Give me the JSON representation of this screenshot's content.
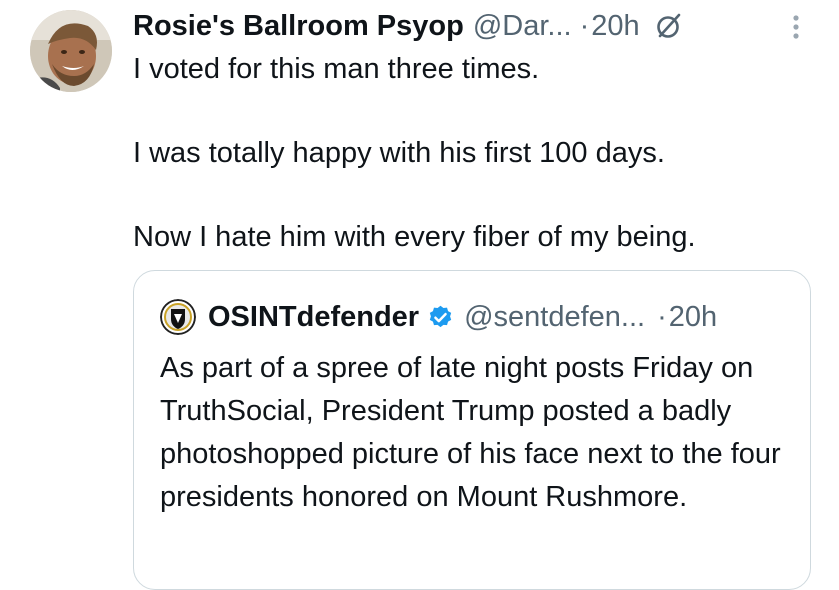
{
  "tweet": {
    "display_name": "Rosie's Ballroom Psyop",
    "handle": "@Dar...",
    "separator": "·",
    "time": "20h",
    "paragraphs": [
      "I voted for this man three times.",
      "I was totally happy with his first 100 days.",
      "Now I hate him with every fiber of my being."
    ],
    "icons": {
      "avatar": "avatar-photo",
      "grok": "grok-icon",
      "more": "more-vertical-icon"
    }
  },
  "quote": {
    "display_name": "OSINTdefender",
    "handle": "@sentdefen...",
    "separator": "·",
    "time": "20h",
    "text": "As part of a spree of late night posts Friday on TruthSocial, President Trump posted a badly photoshopped picture of his face next to the four presidents honored on Mount Rushmore.",
    "icons": {
      "avatar": "osint-logo-avatar",
      "verified": "verified-badge-icon"
    }
  },
  "colors": {
    "text_primary": "#0f1419",
    "text_secondary": "#536471",
    "border": "#cfd9de",
    "verified": "#1d9bf0"
  }
}
